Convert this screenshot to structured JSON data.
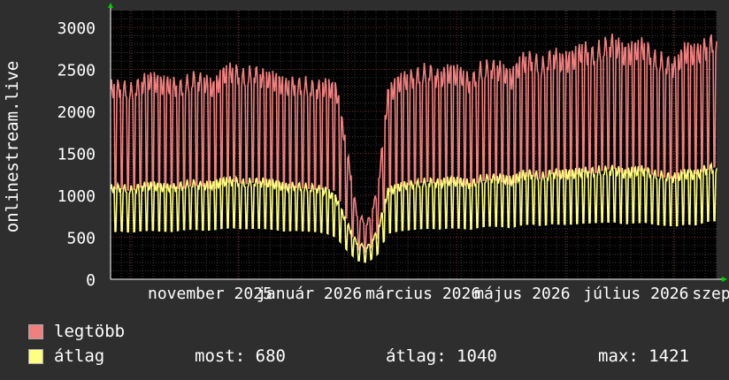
{
  "chart_data": {
    "type": "line",
    "ylabel": "onlinestream.live",
    "ylim": [
      0,
      3200
    ],
    "yticks": [
      0,
      500,
      1000,
      1500,
      2000,
      2500,
      3000
    ],
    "xticks": [
      "november 2025",
      "január 2026",
      "március 2026",
      "május 2026",
      "július 2026",
      "szeptember"
    ],
    "grid": true,
    "series": [
      {
        "name": "legtöbb",
        "color": "#f08080",
        "periods": 43,
        "start_period": 1,
        "values": [
          2380,
          2400,
          2350,
          2450,
          2480,
          2430,
          2420,
          2400,
          2500,
          2470,
          2380,
          2550,
          2600,
          2520,
          2580,
          2500,
          2480,
          2400,
          2430,
          2420,
          2380,
          2400,
          2350,
          1600,
          800,
          700,
          1100,
          2300,
          2450,
          2500,
          2550,
          2600,
          2500,
          2580,
          2550,
          2450,
          2600,
          2650,
          2600,
          2500,
          2700,
          2750,
          2650,
          2800,
          2700,
          2750,
          2850,
          2800,
          2900,
          2950,
          2800,
          2850,
          2900,
          2750,
          2700,
          2650,
          2850,
          2800,
          2900,
          3000
        ]
      },
      {
        "name": "átlag",
        "color": "#ffff80",
        "values": [
          1130,
          1150,
          1120,
          1160,
          1170,
          1150,
          1140,
          1180,
          1200,
          1170,
          1180,
          1220,
          1230,
          1200,
          1220,
          1210,
          1190,
          1150,
          1170,
          1150,
          1140,
          1100,
          1000,
          700,
          450,
          400,
          600,
          1100,
          1150,
          1180,
          1200,
          1220,
          1200,
          1230,
          1220,
          1190,
          1250,
          1270,
          1260,
          1230,
          1300,
          1320,
          1280,
          1330,
          1310,
          1320,
          1340,
          1350,
          1360,
          1370,
          1320,
          1350,
          1360,
          1310,
          1290,
          1270,
          1320,
          1300,
          1380,
          1400
        ]
      }
    ]
  },
  "legend": {
    "max_label": "legtöbb",
    "avg_label": "átlag",
    "now_text": "most: 680",
    "avg_text": "átlag: 1040",
    "max_text": "max: 1421"
  }
}
